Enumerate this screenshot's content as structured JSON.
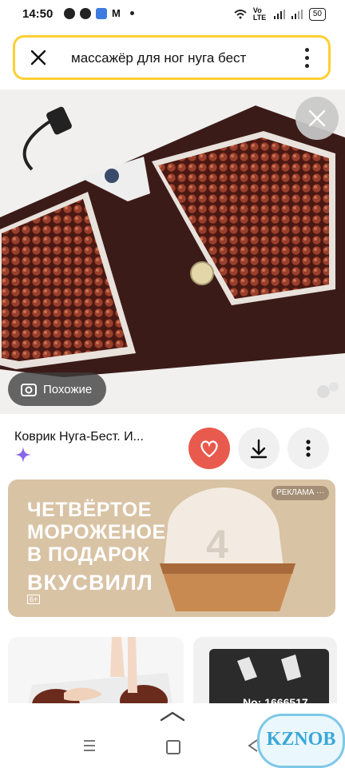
{
  "status_bar": {
    "time": "14:50",
    "network": "Vo LTE",
    "battery": "50"
  },
  "search": {
    "query": "массажёр для ног нуга бест"
  },
  "image_viewer": {
    "similar_label": "Похожие"
  },
  "product": {
    "title": "Коврик Нуга-Бест. И..."
  },
  "ad": {
    "line1": "ЧЕТВЁРТОЕ",
    "line2": "МОРОЖЕНОЕ",
    "line3": "В ПОДАРОК",
    "brand": "ВКУСВИЛЛ",
    "tag": "РЕКЛАМА ···",
    "age": "6+",
    "cup_number": "4"
  },
  "results": [
    {
      "code": ""
    },
    {
      "code": "No: 1666517"
    }
  ],
  "watermark": {
    "text": "KZNOB"
  },
  "colors": {
    "search_border": "#ffcf33",
    "like_button": "#e95a4e",
    "ad_background": "#d9c3a5"
  }
}
